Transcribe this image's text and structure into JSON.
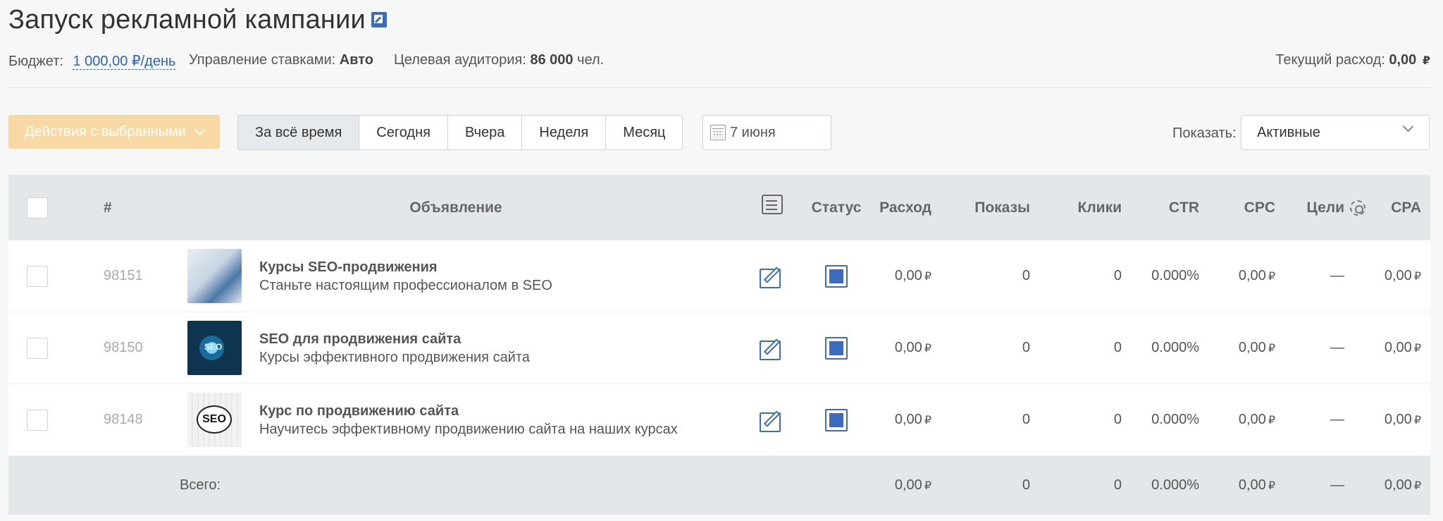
{
  "page": {
    "title": "Запуск рекламной кампании",
    "edit_icon": "edit-square-icon"
  },
  "meta": {
    "budget_label": "Бюджет:",
    "budget_value": "1 000,00 ₽/день",
    "bid_label": "Управление ставками:",
    "bid_value": "Авто",
    "audience_label": "Целевая аудитория:",
    "audience_value": "86 000",
    "audience_unit": "чел.",
    "spend_label": "Текущий расход:",
    "spend_value": "0,00",
    "currency": "₽"
  },
  "toolbar": {
    "actions_label": "Действия с выбранными",
    "periods": [
      "За всё время",
      "Сегодня",
      "Вчера",
      "Неделя",
      "Месяц"
    ],
    "active_period": "За всё время",
    "date_value": "7 июня",
    "show_label": "Показать:",
    "show_value": "Активные"
  },
  "table": {
    "columns": {
      "num": "#",
      "ad": "Объявление",
      "status": "Статус",
      "spend": "Расход",
      "impressions": "Показы",
      "clicks": "Клики",
      "ctr": "CTR",
      "cpc": "CPC",
      "goals": "Цели",
      "cpa": "CPA"
    },
    "rows": [
      {
        "id": "98151",
        "title": "Курсы SEO-продвижения",
        "desc": "Станьте настоящим профессионалом в SEO",
        "spend": "0,00",
        "impressions": "0",
        "clicks": "0",
        "ctr": "0.000%",
        "cpc": "0,00",
        "goals": "—",
        "cpa": "0,00"
      },
      {
        "id": "98150",
        "title": "SEO для продвижения сайта",
        "desc": "Курсы эффективного продвижения сайта",
        "spend": "0,00",
        "impressions": "0",
        "clicks": "0",
        "ctr": "0.000%",
        "cpc": "0,00",
        "goals": "—",
        "cpa": "0,00",
        "thumb_text": "SEO"
      },
      {
        "id": "98148",
        "title": "Курс по продвижению сайта",
        "desc": "Научитесь эффективному продвижению сайта на наших курсах",
        "spend": "0,00",
        "impressions": "0",
        "clicks": "0",
        "ctr": "0.000%",
        "cpc": "0,00",
        "goals": "—",
        "cpa": "0,00",
        "thumb_text": "SEO"
      }
    ],
    "totals": {
      "label": "Всего:",
      "spend": "0,00",
      "impressions": "0",
      "clicks": "0",
      "ctr": "0.000%",
      "cpc": "0,00",
      "goals": "—",
      "cpa": "0,00"
    }
  },
  "colors": {
    "accent": "#3d6bbd",
    "actions_button": "#f8d9a3",
    "header_bg": "#e3e7e9"
  }
}
